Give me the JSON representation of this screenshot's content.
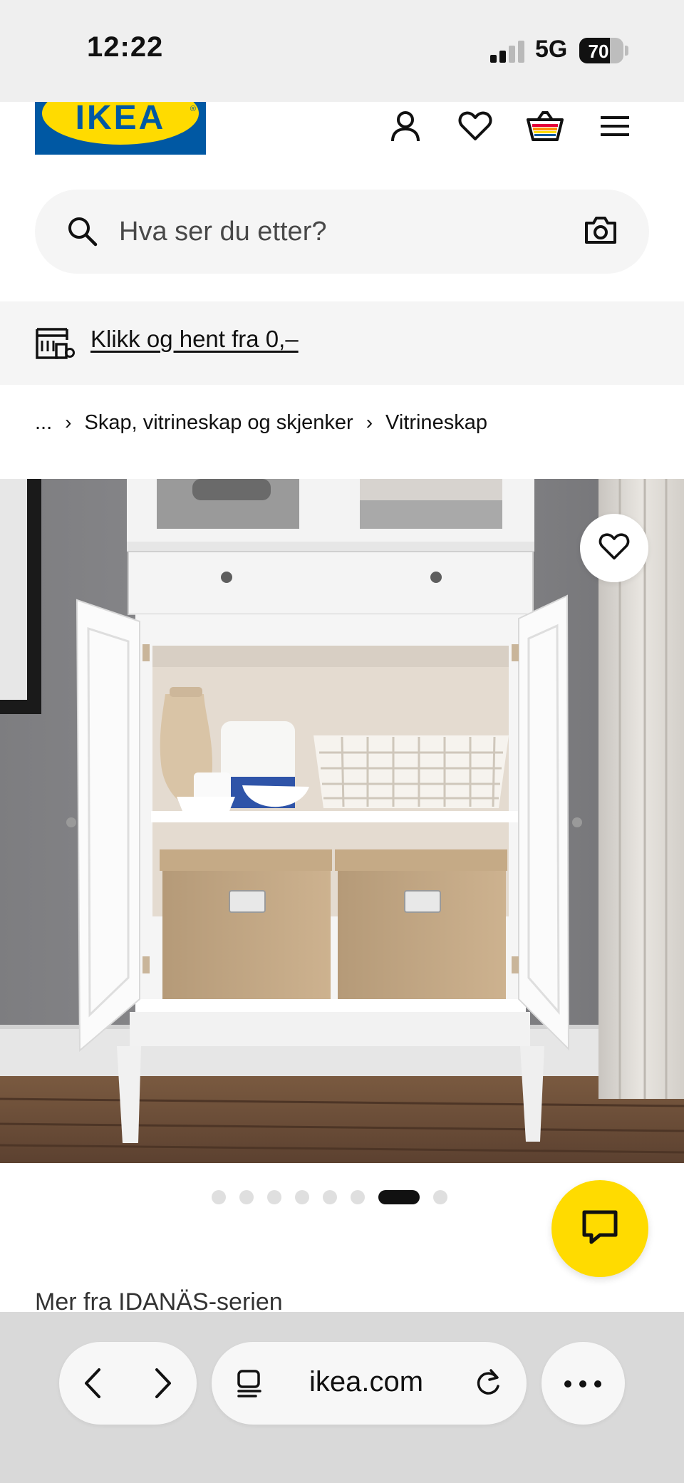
{
  "status_bar": {
    "time": "12:22",
    "network": "5G",
    "battery_percent": "70",
    "signal_bars_filled": 2,
    "signal_bars_total": 4
  },
  "header": {
    "logo_text": "IKEA",
    "logo_reg": "®",
    "icons": [
      "account-icon",
      "favourites-heart-icon",
      "shopping-bag-icon",
      "menu-icon"
    ]
  },
  "search": {
    "placeholder": "Hva ser du etter?",
    "icons": [
      "search-icon",
      "camera-icon"
    ]
  },
  "promo": {
    "link_text": "Klikk og hent fra 0,–",
    "icon": "click-and-collect-store-icon"
  },
  "breadcrumb": {
    "ellipsis": "...",
    "items": [
      "Skap, vitrineskap og skjenker",
      "Vitrineskap"
    ]
  },
  "gallery": {
    "image_count": 8,
    "active_index": 6
  },
  "chat": {
    "icon": "chat-icon"
  },
  "series": {
    "title": "Mer fra IDANÄS-serien"
  },
  "browser": {
    "url": "ikea.com",
    "icons": [
      "back-chevron-icon",
      "forward-chevron-icon",
      "tabs-icon",
      "reload-icon",
      "more-dots-icon"
    ]
  },
  "colors": {
    "ikea_blue": "#0058a3",
    "ikea_yellow": "#ffdb00",
    "text": "#111111",
    "panel_bg": "#f5f5f5"
  }
}
